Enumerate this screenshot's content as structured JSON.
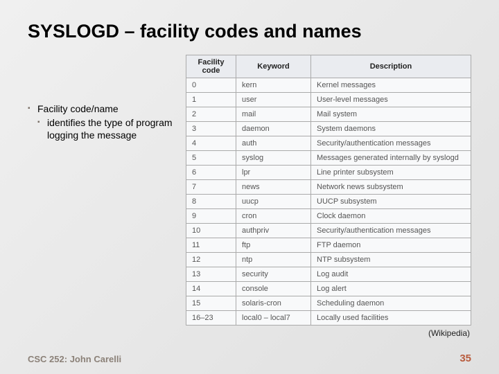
{
  "title": "SYSLOGD – facility codes and names",
  "bullets": {
    "b1": "Facility code/name",
    "b2": "identifies the type of program logging the message"
  },
  "table": {
    "headers": {
      "code": "Facility code",
      "keyword": "Keyword",
      "desc": "Description"
    },
    "rows": [
      {
        "code": "0",
        "keyword": "kern",
        "desc": "Kernel messages"
      },
      {
        "code": "1",
        "keyword": "user",
        "desc": "User-level messages"
      },
      {
        "code": "2",
        "keyword": "mail",
        "desc": "Mail system"
      },
      {
        "code": "3",
        "keyword": "daemon",
        "desc": "System daemons"
      },
      {
        "code": "4",
        "keyword": "auth",
        "desc": "Security/authentication messages"
      },
      {
        "code": "5",
        "keyword": "syslog",
        "desc": "Messages generated internally by syslogd"
      },
      {
        "code": "6",
        "keyword": "lpr",
        "desc": "Line printer subsystem"
      },
      {
        "code": "7",
        "keyword": "news",
        "desc": "Network news subsystem"
      },
      {
        "code": "8",
        "keyword": "uucp",
        "desc": "UUCP subsystem"
      },
      {
        "code": "9",
        "keyword": "cron",
        "desc": "Clock daemon"
      },
      {
        "code": "10",
        "keyword": "authpriv",
        "desc": "Security/authentication messages"
      },
      {
        "code": "11",
        "keyword": "ftp",
        "desc": "FTP daemon"
      },
      {
        "code": "12",
        "keyword": "ntp",
        "desc": "NTP subsystem"
      },
      {
        "code": "13",
        "keyword": "security",
        "desc": "Log audit"
      },
      {
        "code": "14",
        "keyword": "console",
        "desc": "Log alert"
      },
      {
        "code": "15",
        "keyword": "solaris-cron",
        "desc": "Scheduling daemon"
      },
      {
        "code": "16–23",
        "keyword": "local0 – local7",
        "desc": "Locally used facilities"
      }
    ]
  },
  "citation": "(Wikipedia)",
  "footer": {
    "course": "CSC 252: John Carelli",
    "page": "35"
  }
}
